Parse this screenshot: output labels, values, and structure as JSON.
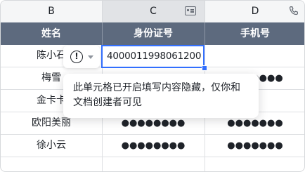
{
  "columns": {
    "b": "B",
    "c": "C",
    "d": "D",
    "c_icon": "id-card-icon",
    "d_icon": "phone-icon"
  },
  "headers": {
    "name": "姓名",
    "id_number": "身份证号",
    "phone": "手机号"
  },
  "rows": [
    {
      "name": "陈小石",
      "id_number": "4000011998061200",
      "phone": ""
    },
    {
      "name": "梅雪",
      "id_number": "",
      "phone": "●●●●●●●"
    },
    {
      "name": "金卡卡",
      "id_number": "",
      "phone": ""
    },
    {
      "name": "欧阳美丽",
      "id_number": "●●●●●●●●",
      "phone": "●●●●●●●"
    },
    {
      "name": "徐小云",
      "id_number": "●●●●●●●●",
      "phone": "●●●●●●●"
    },
    {
      "name": "",
      "id_number": "",
      "phone": ""
    }
  ],
  "alert": {
    "icon": "!",
    "icon_name": "exclamation-circle-icon"
  },
  "tooltip": {
    "line1": "此单元格已开启填写内容隐藏，仅你和",
    "line2": "文档创建者可见"
  },
  "colors": {
    "header_bg": "#5d6a7e",
    "selection": "#3370ff"
  }
}
